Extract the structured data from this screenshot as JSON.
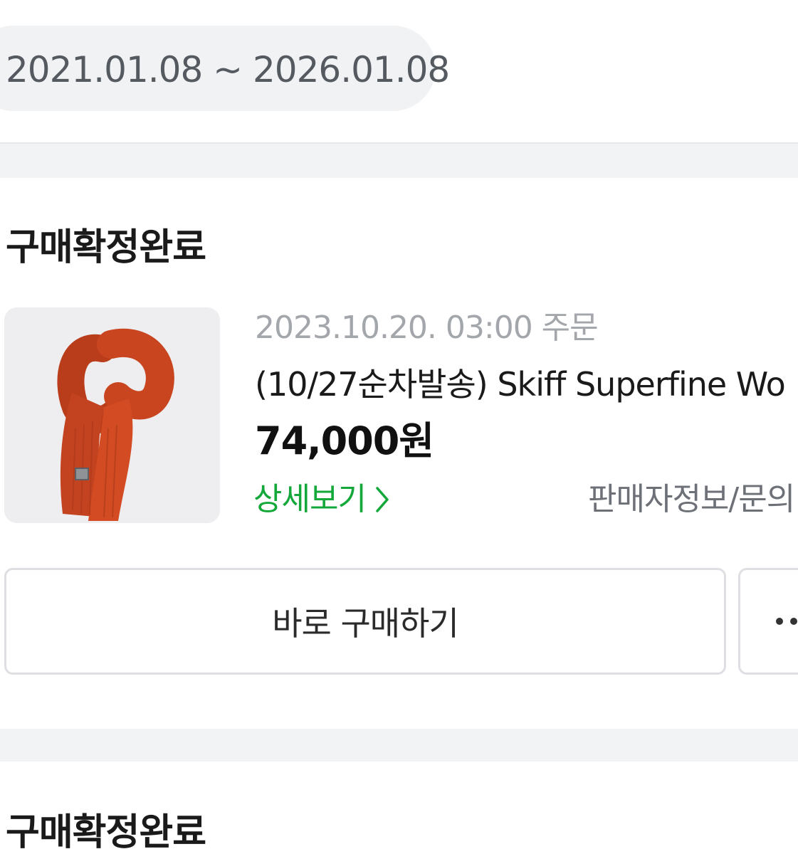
{
  "date_range": "2021.01.08 ~ 2026.01.08",
  "orders": [
    {
      "status": "구매확정완료",
      "order_datetime": "2023.10.20. 03:00 주문",
      "product_name": "(10/27순차발송) Skiff Superfine Wo",
      "price": "74,000원",
      "detail_link": "상세보기",
      "seller_info": "판매자정보/문의",
      "buy_again_label": "바로 구매하기",
      "more_icon": "more-dots-icon",
      "thumbnail_icon": "orange-knit-scarf-image"
    },
    {
      "status": "구매확정완료"
    }
  ],
  "colors": {
    "accent_green": "#14a83b",
    "pill_background": "#f1f2f4",
    "scarf_orange": "#c8451f"
  }
}
